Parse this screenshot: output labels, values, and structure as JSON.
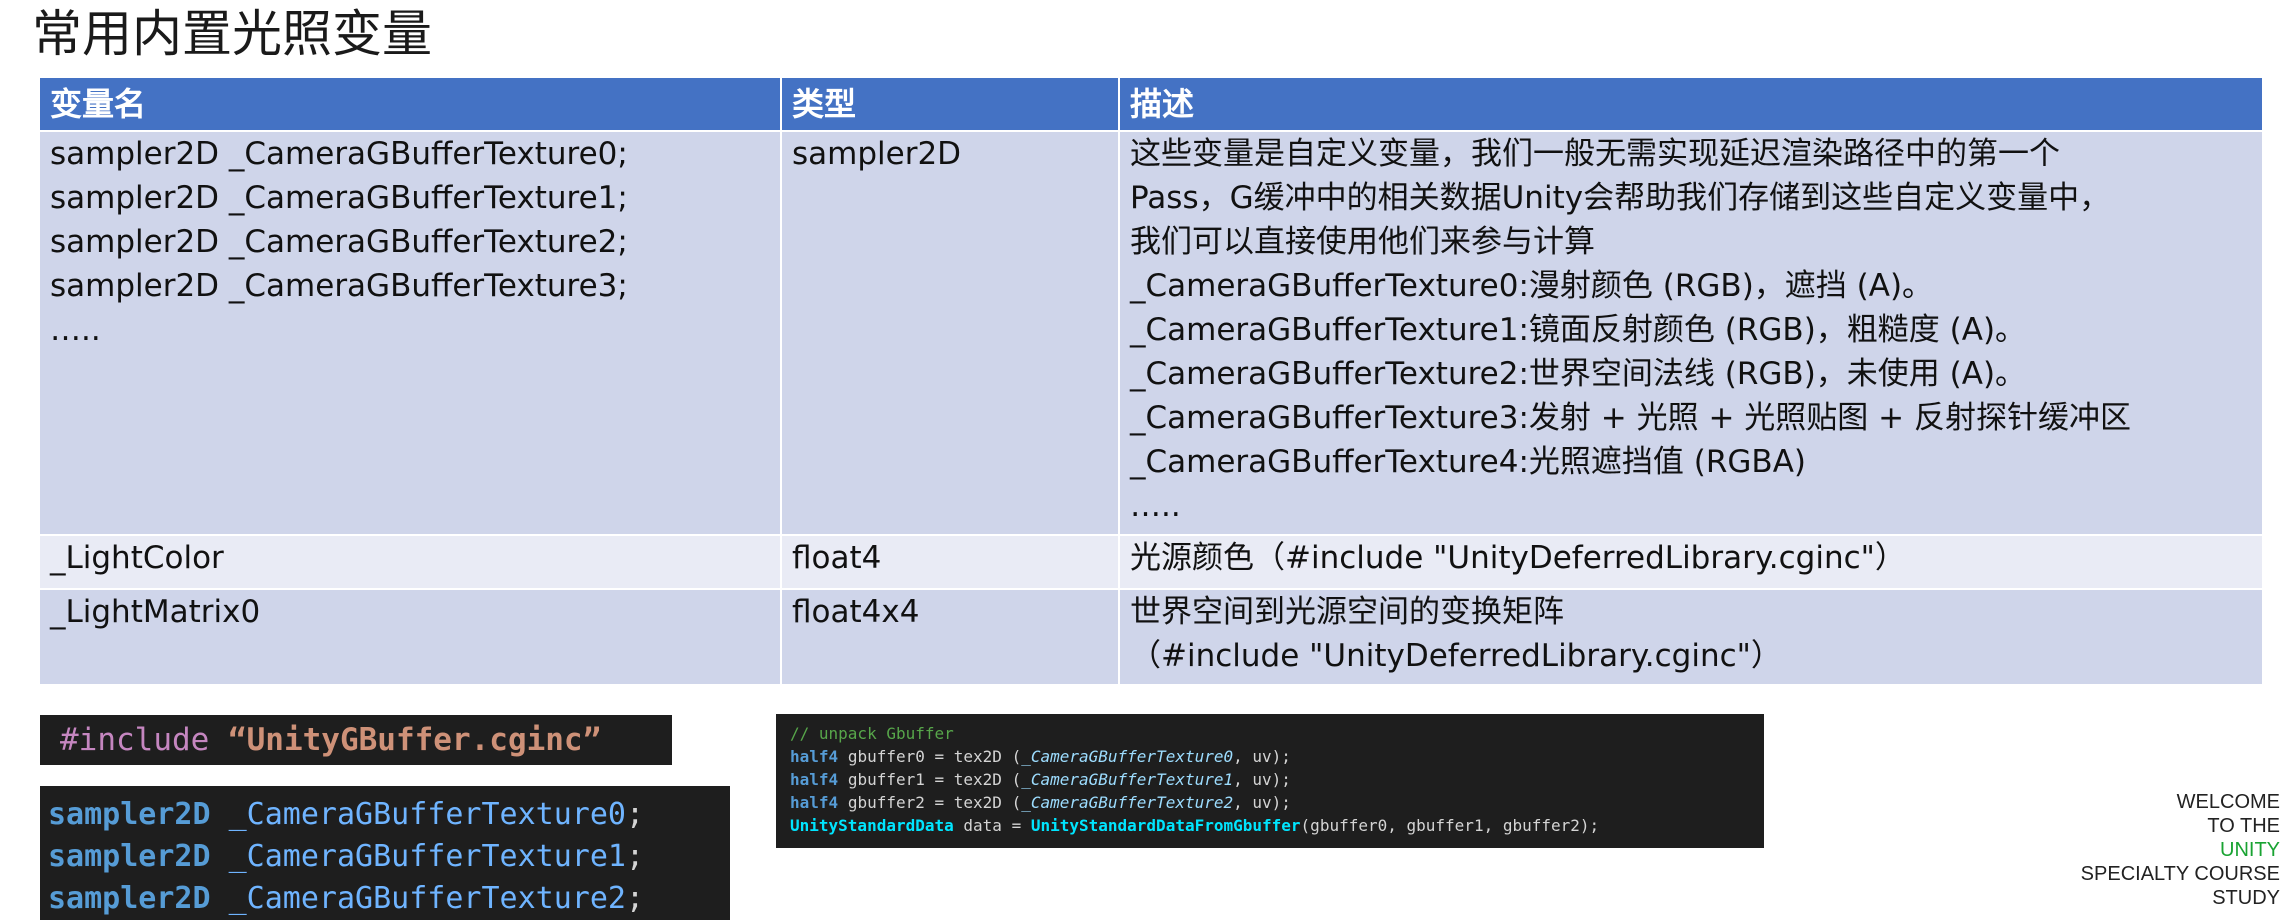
{
  "title": "常用内置光照变量",
  "table": {
    "headers": [
      "变量名",
      "类型",
      "描述"
    ],
    "rows": [
      {
        "name_lines": [
          "sampler2D _CameraGBufferTexture0;",
          "sampler2D _CameraGBufferTexture1;",
          "sampler2D _CameraGBufferTexture2;",
          "sampler2D _CameraGBufferTexture3;",
          "….."
        ],
        "type_lines": [
          "sampler2D"
        ],
        "desc_lines": [
          "这些变量是自定义变量，我们一般无需实现延迟渲染路径中的第一个",
          "Pass，G缓冲中的相关数据Unity会帮助我们存储到这些自定义变量中，",
          "我们可以直接使用他们来参与计算",
          "_CameraGBufferTexture0:漫射颜色 (RGB)，遮挡 (A)。",
          "_CameraGBufferTexture1:镜面反射颜色 (RGB)，粗糙度 (A)。",
          "_CameraGBufferTexture2:世界空间法线 (RGB)，未使用 (A)。",
          "_CameraGBufferTexture3:发射 + 光照 + 光照贴图 + 反射探针缓冲区",
          "_CameraGBufferTexture4:光照遮挡值 (RGBA)",
          "….."
        ]
      },
      {
        "name_lines": [
          "_LightColor"
        ],
        "type_lines": [
          "float4"
        ],
        "desc_lines": [
          "光源颜色（#include \"UnityDeferredLibrary.cginc\"）"
        ]
      },
      {
        "name_lines": [
          "_LightMatrix0"
        ],
        "type_lines": [
          "float4x4"
        ],
        "desc_lines": [
          "世界空间到光源空间的变换矩阵",
          "（#include \"UnityDeferredLibrary.cginc\"）"
        ]
      }
    ]
  },
  "code_include": {
    "directive": "#include",
    "file": "“UnityGBuffer.cginc”"
  },
  "code_samplers": [
    {
      "type": "sampler2D",
      "name": "_CameraGBufferTexture0",
      "end": ";"
    },
    {
      "type": "sampler2D",
      "name": "_CameraGBufferTexture1",
      "end": ";"
    },
    {
      "type": "sampler2D",
      "name": "_CameraGBufferTexture2",
      "end": ";"
    }
  ],
  "code_unpack": {
    "comment": "// unpack Gbuffer",
    "lines": [
      {
        "type": "half4",
        "var": "gbuffer0",
        "mid": " = tex2D (",
        "arg": "_CameraGBufferTexture0",
        "end": ", uv);"
      },
      {
        "type": "half4",
        "var": "gbuffer1",
        "mid": " = tex2D (",
        "arg": "_CameraGBufferTexture1",
        "end": ", uv);"
      },
      {
        "type": "half4",
        "var": "gbuffer2",
        "mid": " = tex2D (",
        "arg": "_CameraGBufferTexture2",
        "end": ", uv);"
      }
    ],
    "last": {
      "type": "UnityStandardData",
      "var": " data = ",
      "func": "UnityStandardDataFromGbuffer",
      "args": "(gbuffer0, gbuffer1, gbuffer2);"
    }
  },
  "brand": {
    "lines": [
      "WELCOME",
      "TO THE",
      "UNITY",
      "SPECIALTY COURSE",
      "STUDY"
    ],
    "accent_color": "#19a332"
  },
  "colors": {
    "header_bg": "#4472c4",
    "band1": "#cfd5ea",
    "band2": "#e9ebf5",
    "code_bg": "#1e1e1e"
  }
}
